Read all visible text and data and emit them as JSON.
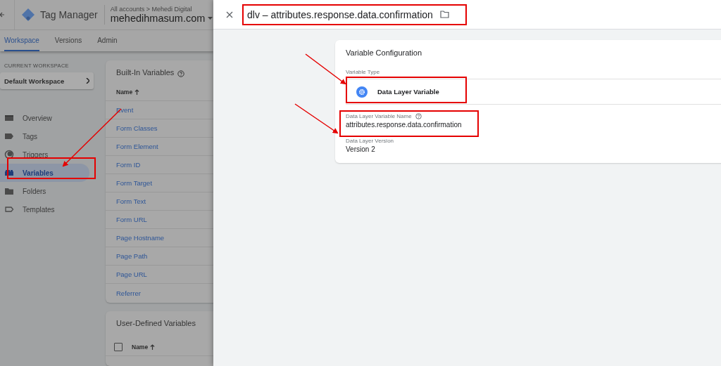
{
  "header": {
    "product": "Tag Manager",
    "breadcrumb": "All accounts > Mehedi Digital",
    "account": "mehedihmasum.com"
  },
  "tabs": [
    {
      "label": "Workspace",
      "selected": true
    },
    {
      "label": "Versions",
      "selected": false
    },
    {
      "label": "Admin",
      "selected": false
    }
  ],
  "workspace": {
    "label": "CURRENT WORKSPACE",
    "name": "Default Workspace"
  },
  "nav": [
    {
      "label": "Overview",
      "selected": false
    },
    {
      "label": "Tags",
      "selected": false
    },
    {
      "label": "Triggers",
      "selected": false
    },
    {
      "label": "Variables",
      "selected": true
    },
    {
      "label": "Folders",
      "selected": false
    },
    {
      "label": "Templates",
      "selected": false
    }
  ],
  "built_in": {
    "title": "Built-In Variables",
    "column": "Name",
    "rows": [
      "Event",
      "Form Classes",
      "Form Element",
      "Form ID",
      "Form Target",
      "Form Text",
      "Form URL",
      "Page Hostname",
      "Page Path",
      "Page URL",
      "Referrer"
    ]
  },
  "user_defined": {
    "title": "User-Defined Variables",
    "column": "Name",
    "checked": false
  },
  "panel": {
    "title": "dlv – attributes.response.data.confirmation",
    "card_title": "Variable Configuration",
    "type_label": "Variable Type",
    "type": "Data Layer Variable",
    "fields": [
      {
        "label": "Data Layer Variable Name",
        "help": true,
        "value": "attributes.response.data.confirmation"
      },
      {
        "label": "Data Layer Version",
        "help": false,
        "value": "Version 2"
      }
    ]
  }
}
